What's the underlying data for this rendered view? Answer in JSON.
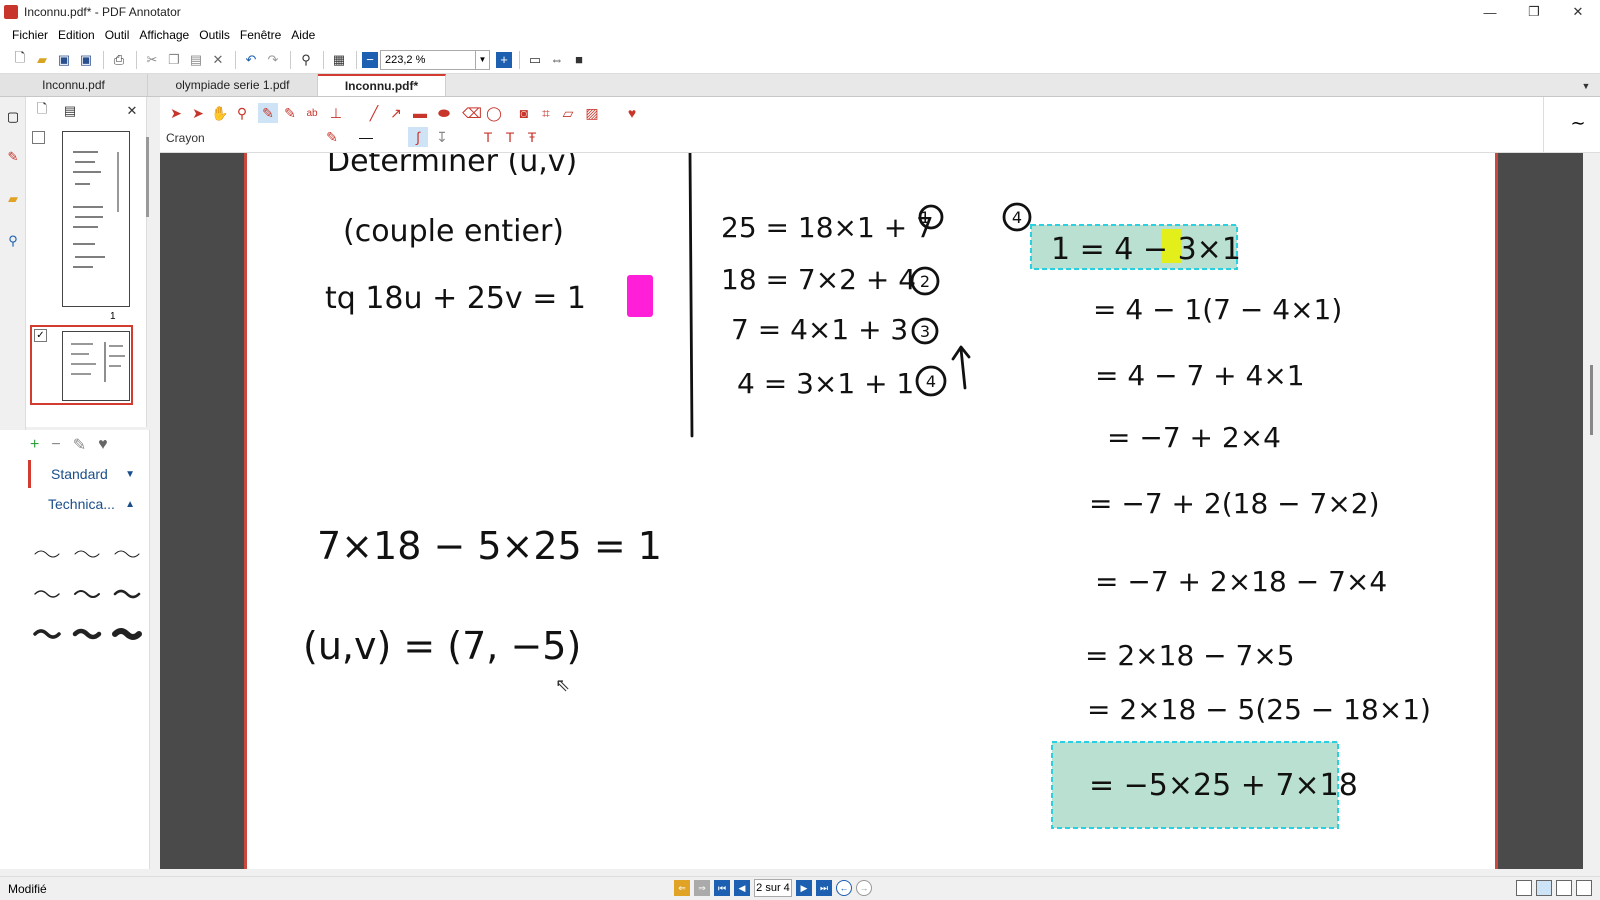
{
  "window": {
    "title": "Inconnu.pdf* - PDF Annotator",
    "minimize": "—",
    "restore": "❐",
    "close": "✕"
  },
  "menu": [
    "Fichier",
    "Edition",
    "Outil",
    "Affichage",
    "Outils",
    "Fenêtre",
    "Aide"
  ],
  "toolbar": {
    "zoom_value": "223,2 %"
  },
  "tabs": [
    "Inconnu.pdf",
    "olympiade serie 1.pdf",
    "Inconnu.pdf*"
  ],
  "active_tab": 2,
  "thumbnails": {
    "page1_number": "1"
  },
  "favorites": {
    "groups": [
      "Standard",
      "Technica..."
    ]
  },
  "annotation_toolbar": {
    "current_tool": "Crayon"
  },
  "page_content": {
    "left": [
      "Déterminer (u,v)",
      "(couple entier)",
      "tq   18u + 25v = 1",
      "7×18 − 5×25 = 1",
      "(u,v)   =  (7, −5)"
    ],
    "middle": [
      "25 = 18×1 + 7",
      "18 = 7×2 + 4",
      "7 = 4×1 + 3",
      "4 = 3×1 + 1"
    ],
    "middle_marks": [
      "1",
      "2",
      "3",
      "4"
    ],
    "right_mark": "4",
    "right": [
      "1 = 4 − 3×1",
      "= 4 − 1(7 − 4×1)",
      "= 4 − 7 + 4×1",
      "= −7 + 2×4",
      "= −7 + 2(18 − 7×2)",
      "= −7 + 2×18 − 7×4",
      "= 2×18 − 7×5",
      "= 2×18 − 5(25 − 18×1)",
      "= −5×25 + 7×18"
    ]
  },
  "statusbar": {
    "left": "Modifié",
    "page_indicator": "2 sur 4"
  }
}
